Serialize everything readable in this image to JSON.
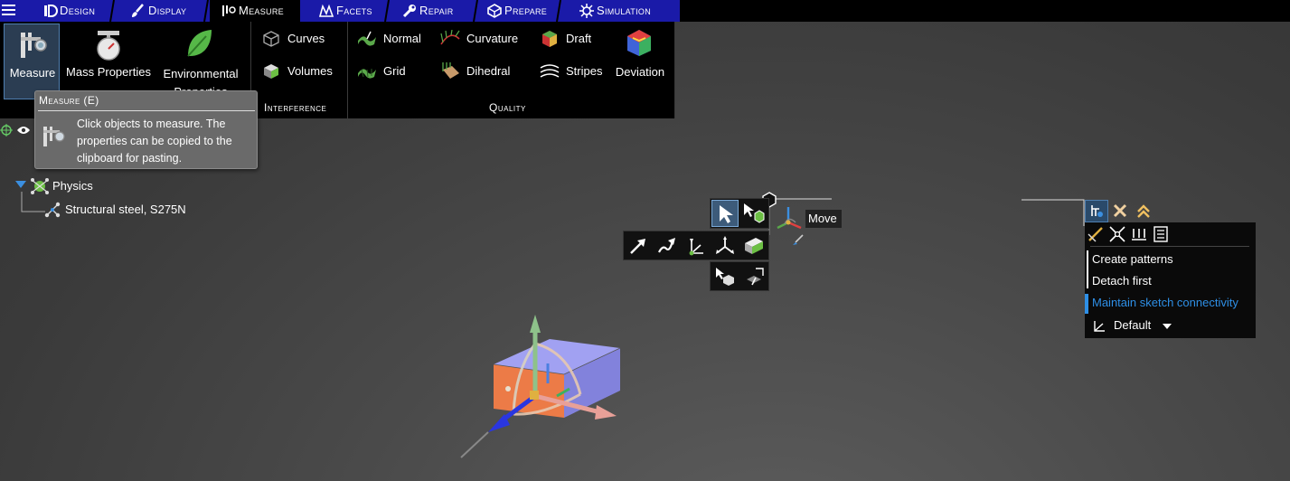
{
  "tabs": [
    {
      "label": "Design",
      "icon": "design-icon"
    },
    {
      "label": "Display",
      "icon": "brush-icon"
    },
    {
      "label": "Measure",
      "icon": "caliper-icon"
    },
    {
      "label": "Facets",
      "icon": "facets-icon"
    },
    {
      "label": "Repair",
      "icon": "wrench-icon"
    },
    {
      "label": "Prepare",
      "icon": "prepare-icon"
    },
    {
      "label": "Simulation",
      "icon": "simulation-icon"
    }
  ],
  "ribbon": {
    "measure_label": "Measure",
    "mass_properties_label": "Mass Properties",
    "environmental_label": "Environmental Properties",
    "curves_label": "Curves",
    "volumes_label": "Volumes",
    "interference_group": "Interference",
    "normal_label": "Normal",
    "grid_label": "Grid",
    "curvature_label": "Curvature",
    "dihedral_label": "Dihedral",
    "draft_label": "Draft",
    "stripes_label": "Stripes",
    "deviation_label": "Deviation",
    "quality_group": "Quality"
  },
  "tooltip": {
    "title": "Measure (E)",
    "body": "Click objects to measure. The properties can be copied to the clipboard for pasting."
  },
  "tree": {
    "physics_label": "Physics",
    "material_label": "Structural steel, S275N"
  },
  "move_tool": {
    "label": "Move"
  },
  "options_panel": {
    "create_patterns": "Create patterns",
    "detach_first": "Detach first",
    "maintain_sketch": "Maintain sketch connectivity",
    "default_label": "Default"
  },
  "colors": {
    "tab_blue": "#1a1aa8",
    "highlight_blue": "#2e8fe6",
    "box_top": "#9f9ff5",
    "box_front": "#ee7a44"
  }
}
